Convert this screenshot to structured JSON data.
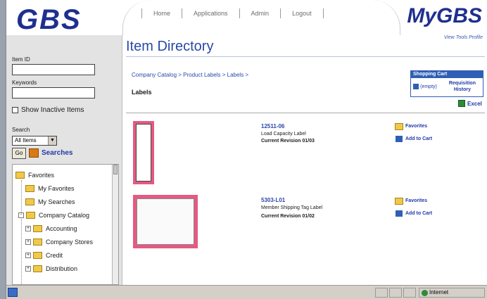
{
  "header": {
    "logo": "GBS",
    "brand": "MyGBS",
    "nav": [
      "Home",
      "Applications",
      "Admin",
      "Logout"
    ],
    "top_links": "View Tools Profile"
  },
  "sidebar": {
    "item_id_label": "Item ID",
    "keywords_label": "Keywords",
    "show_inactive_label": "Show Inactive Items",
    "search_label": "Search",
    "search_scope": "All Items",
    "go_label": "Go",
    "saved_searches_label": "Searches",
    "tree": [
      "Favorites",
      "My Favorites",
      "My Searches",
      "Company Catalog",
      "Accounting",
      "Company Stores",
      "Credit",
      "Distribution"
    ]
  },
  "main": {
    "title": "Item Directory",
    "breadcrumb": "Company Catalog > Product Labels > Labels >",
    "category": "Labels",
    "cart": {
      "title": "Shopping Cart",
      "empty_label": "(empty)",
      "requisition_label": "Requisition History"
    },
    "excel_label": "Excel",
    "items": [
      {
        "id": "12511-06",
        "description": "Load Capacity Label",
        "status": "Current Revision 01/03",
        "favorites_label": "Favorites",
        "add_label": "Add to Cart"
      },
      {
        "id": "5303-L01",
        "description": "Member Shipping Tag Label",
        "status": "Current Revision 01/02",
        "favorites_label": "Favorites",
        "add_label": "Add to Cart"
      }
    ]
  },
  "statusbar": {
    "zone": "Internet"
  }
}
